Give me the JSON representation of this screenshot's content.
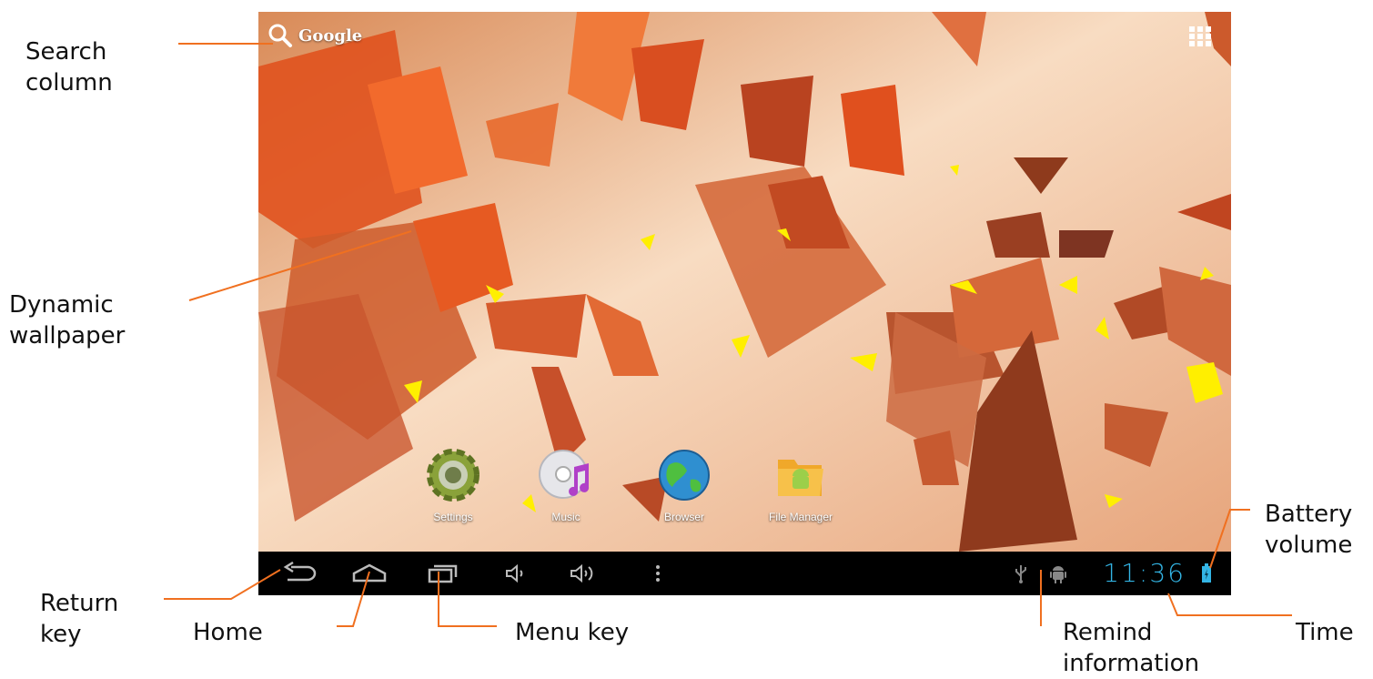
{
  "callouts": {
    "search": "Search\ncolumn",
    "wallpaper": "Dynamic\nwallpaper",
    "return": "Return\nkey",
    "home": "Home",
    "menu": "Menu key",
    "remind": "Remind\ninformation",
    "time": "Time",
    "battery": "Battery\nvolume"
  },
  "search_bar": {
    "label": "Google",
    "icon": "magnifier-icon"
  },
  "apps": [
    {
      "label": "Settings",
      "icon": "gear-icon"
    },
    {
      "label": "Music",
      "icon": "cd-music-icon"
    },
    {
      "label": "Browser",
      "icon": "globe-icon"
    },
    {
      "label": "File Manager",
      "icon": "folder-android-icon"
    }
  ],
  "navbar": {
    "buttons": [
      "back-icon",
      "home-icon",
      "recent-apps-icon",
      "volume-down-icon",
      "volume-up-icon",
      "overflow-menu-icon"
    ],
    "status_icons": [
      "usb-icon",
      "android-debug-icon",
      "battery-icon"
    ],
    "time": "11:36"
  },
  "colors": {
    "leader_line": "#f07020",
    "clock": "#33b5e5",
    "navbar": "#000000"
  }
}
